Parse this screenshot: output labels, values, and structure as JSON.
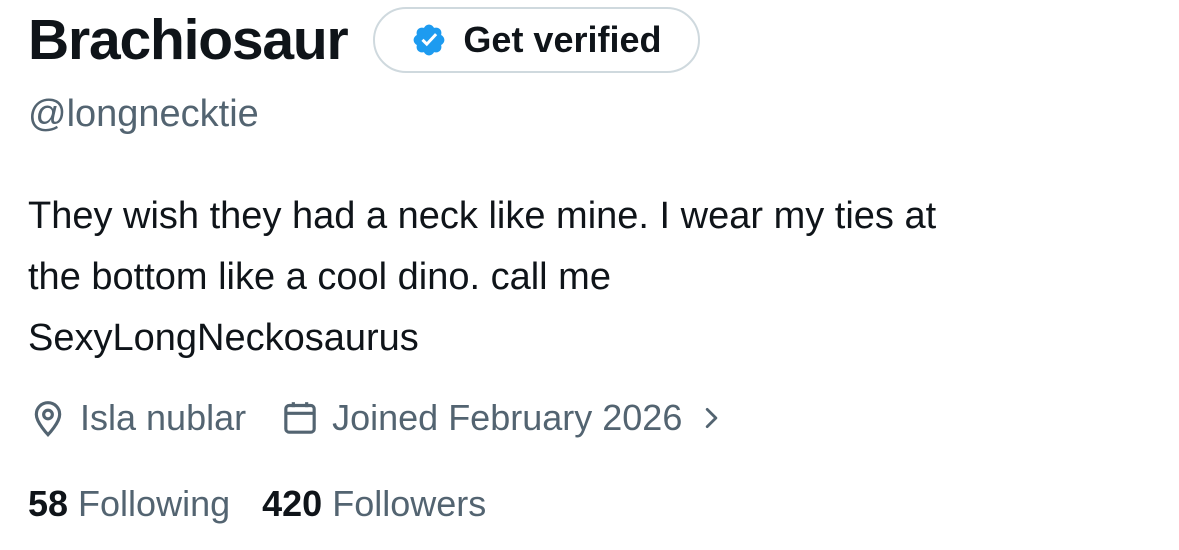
{
  "profile": {
    "display_name": "Brachiosaur",
    "handle": "@longnecktie",
    "bio_lines": [
      "They wish they had a neck like mine. I wear my ties at",
      "the bottom like a cool dino. call me",
      "SexyLongNeckosaurus"
    ],
    "location": "Isla nublar",
    "joined": "Joined February 2026",
    "following_count": "58",
    "following_label": "Following",
    "followers_count": "420",
    "followers_label": "Followers"
  },
  "verify_button": {
    "label": "Get verified",
    "icon": "verified-badge-icon"
  },
  "icons": {
    "location": "location-pin-icon",
    "joined": "calendar-icon",
    "chevron": "chevron-right-icon"
  },
  "colors": {
    "primary_text": "#0f1419",
    "secondary_text": "#536471",
    "badge_blue": "#1d9bf0",
    "button_border": "#cfd9de"
  }
}
